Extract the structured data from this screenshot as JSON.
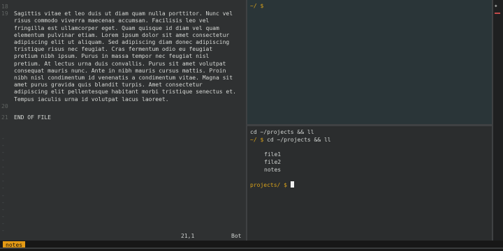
{
  "editor": {
    "lines": [
      {
        "num": "18",
        "text": ""
      },
      {
        "num": "19",
        "text": "Sagittis vitae et leo duis ut diam quam nulla porttitor. Nunc vel risus commodo viverra maecenas accumsan. Facilisis leo vel fringilla est ullamcorper eget. Quam quisque id diam vel quam elementum pulvinar etiam. Lorem ipsum dolor sit amet consectetur adipiscing elit ut aliquam. Sed adipiscing diam donec adipiscing tristique risus nec feugiat. Cras fermentum odio eu feugiat pretium nibh ipsum. Purus in massa tempor nec feugiat nisl pretium. At lectus urna duis convallis. Purus sit amet volutpat consequat mauris nunc. Ante in nibh mauris cursus mattis. Proin nibh nisl condimentum id venenatis a condimentum vitae. Magna sit amet purus gravida quis blandit turpis. Amet consectetur adipiscing elit pellentesque habitant morbi tristique senectus et. Tempus iaculis urna id volutpat lacus laoreet."
      },
      {
        "num": "20",
        "text": ""
      },
      {
        "num": "21",
        "text": "END OF FILE"
      }
    ],
    "ruler_position": "21,1",
    "ruler_scroll": "Bot"
  },
  "term_top": {
    "prompt": "~/ $"
  },
  "term_bottom": {
    "echo_cmd": "cd ~/projects && ll",
    "prompt1": "~/ $",
    "cmd1": "cd ~/projects && ll",
    "files": [
      "file1",
      "file2",
      "notes"
    ],
    "prompt2": "projects/ $"
  },
  "status": {
    "tab": "notes"
  },
  "colors": {
    "accent": "#e49a14",
    "prompt": "#d8a21a"
  }
}
